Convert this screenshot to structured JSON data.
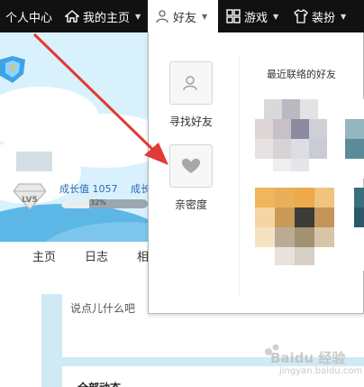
{
  "nav": {
    "personal_center": "个人中心",
    "my_home": "我的主页",
    "friends": "好友",
    "games": "游戏",
    "dress": "装扮"
  },
  "profile": {
    "growth_label": "成长值 1057",
    "growth_label_cut": "成长",
    "progress_text": "32%",
    "progress_fraction": 0.32,
    "level_text": "LV5"
  },
  "tabs": [
    "主页",
    "日志",
    "相"
  ],
  "post": {
    "placeholder": "说点儿什么吧"
  },
  "feed": {
    "title": "全部动态"
  },
  "dropdown": {
    "find_friends": "寻找好友",
    "intimacy": "亲密度",
    "recent_title": "最近联络的好友"
  },
  "watermark": {
    "brand": "Baidu 经验",
    "url": "jingyan.baidu.com"
  },
  "colors": {
    "nav_bg": "#111111",
    "accent_blue": "#2a6ab6",
    "arrow_red": "#e23a35",
    "profile_bg": "#d9f1fc"
  }
}
